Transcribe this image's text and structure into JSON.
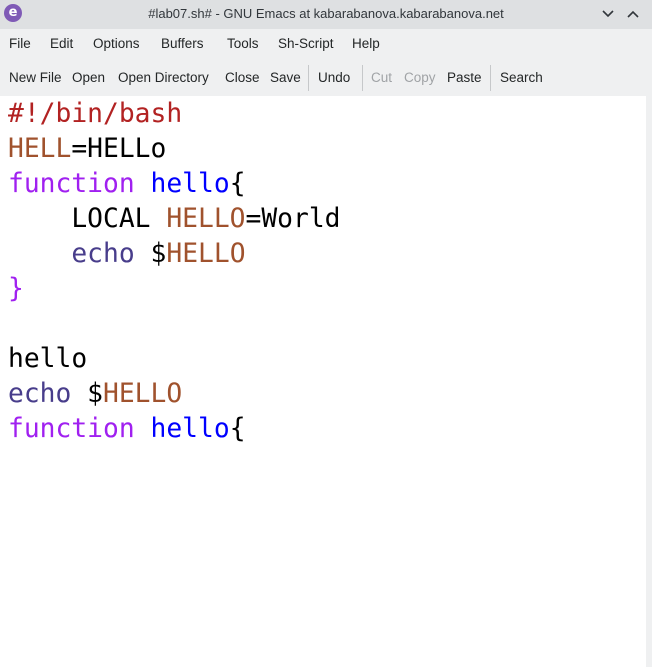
{
  "window": {
    "title": "#lab07.sh# - GNU Emacs at kabarabanova.kabarabanova.net",
    "app_icon": "emacs-icon",
    "app_icon_glyph": "e"
  },
  "menubar": {
    "items": [
      "File",
      "Edit",
      "Options",
      "Buffers",
      "Tools",
      "Sh-Script",
      "Help"
    ]
  },
  "toolbar": {
    "new_file": "New File",
    "open": "Open",
    "open_directory": "Open Directory",
    "close": "Close",
    "save": "Save",
    "undo": "Undo",
    "cut": "Cut",
    "copy": "Copy",
    "paste": "Paste",
    "search": "Search",
    "disabled": [
      "Cut",
      "Copy"
    ]
  },
  "colors": {
    "keyword": "#a020f0",
    "comment": "#b22222",
    "function_name": "#0000ff",
    "variable": "#a0522d",
    "builtin": "#483d8b",
    "text": "#000000"
  },
  "editor": {
    "lines": [
      [
        {
          "t": "#!/bin/bash",
          "c": "com"
        }
      ],
      [
        {
          "t": "HELL",
          "c": "var"
        },
        {
          "t": "=HELLo",
          "c": ""
        }
      ],
      [
        {
          "t": "function",
          "c": "kw"
        },
        {
          "t": " ",
          "c": ""
        },
        {
          "t": "hello",
          "c": "fn"
        },
        {
          "t": "{",
          "c": ""
        }
      ],
      [
        {
          "t": "    LOCAL ",
          "c": ""
        },
        {
          "t": "HELLO",
          "c": "var"
        },
        {
          "t": "=World",
          "c": ""
        }
      ],
      [
        {
          "t": "    ",
          "c": ""
        },
        {
          "t": "echo",
          "c": "bi"
        },
        {
          "t": " $",
          "c": ""
        },
        {
          "t": "HELLO",
          "c": "var"
        }
      ],
      [
        {
          "t": "}",
          "c": "kw"
        }
      ],
      [],
      [
        {
          "t": "hello",
          "c": ""
        }
      ],
      [
        {
          "t": "echo",
          "c": "bi"
        },
        {
          "t": " $",
          "c": ""
        },
        {
          "t": "HELLO",
          "c": "var"
        }
      ],
      [
        {
          "t": "function",
          "c": "kw"
        },
        {
          "t": " ",
          "c": ""
        },
        {
          "t": "hello",
          "c": "fn"
        },
        {
          "t": "{",
          "c": ""
        }
      ]
    ]
  }
}
